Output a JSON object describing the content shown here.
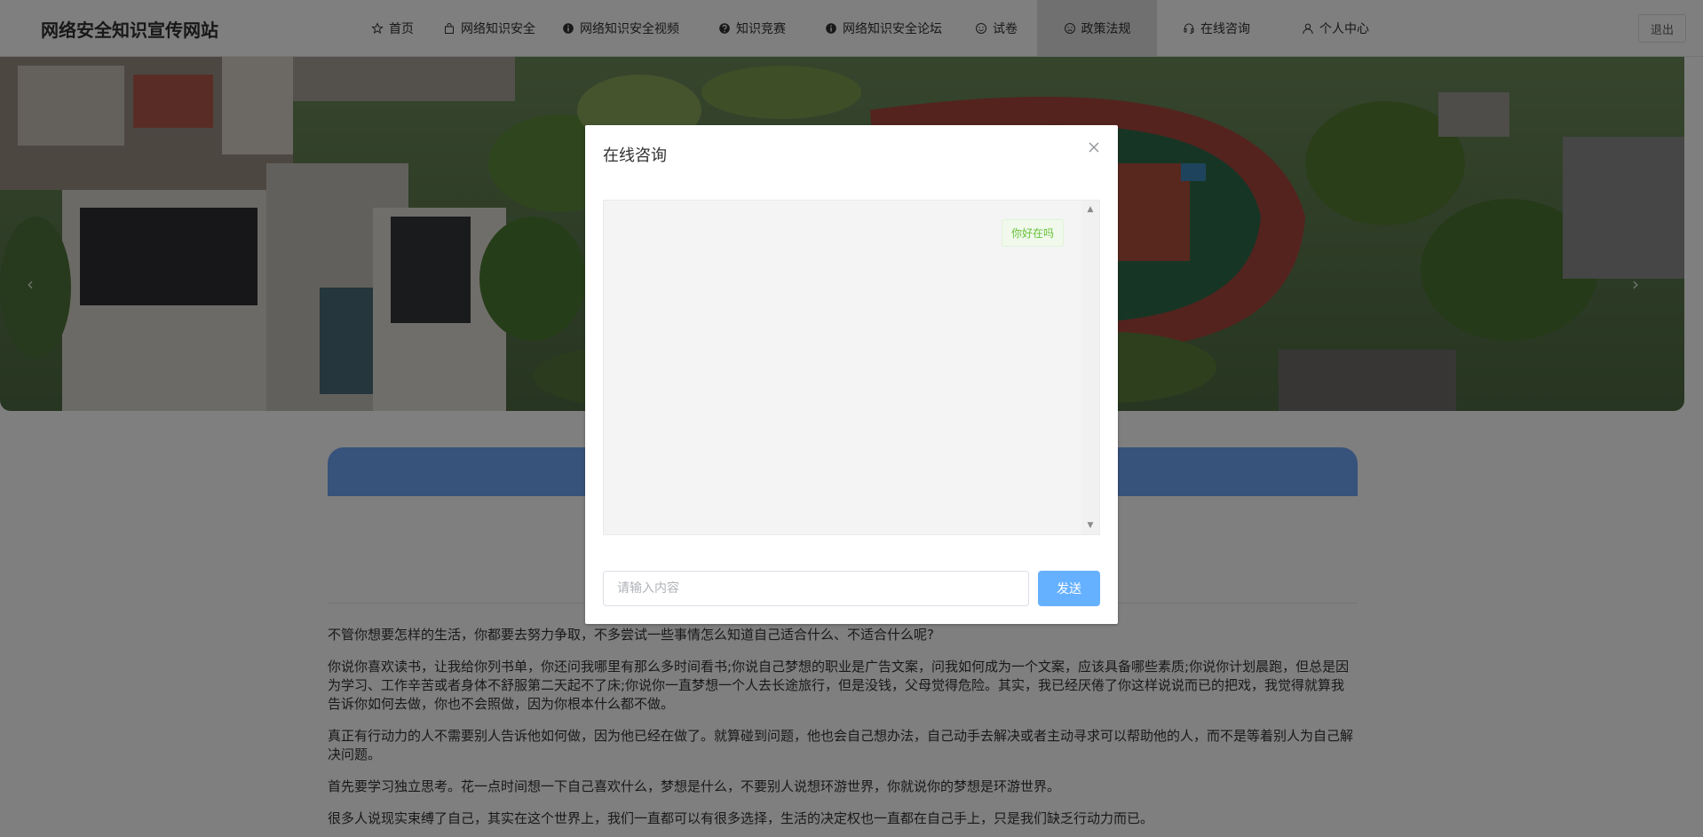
{
  "header": {
    "site_title": "网络安全知识宣传网站",
    "logout_label": "退出",
    "nav": [
      {
        "label": "首页",
        "icon": "star-icon",
        "active": false
      },
      {
        "label": "网络知识安全",
        "icon": "bag-icon",
        "active": false
      },
      {
        "label": "网络知识安全视频",
        "icon": "info-icon",
        "active": false
      },
      {
        "label": "知识竞赛",
        "icon": "question-icon",
        "active": false
      },
      {
        "label": "网络知识安全论坛",
        "icon": "info-icon",
        "active": false
      },
      {
        "label": "试卷",
        "icon": "smile-icon",
        "active": false
      },
      {
        "label": "政策法规",
        "icon": "sad-icon",
        "active": true
      },
      {
        "label": "在线咨询",
        "icon": "headset-icon",
        "active": false
      },
      {
        "label": "个人中心",
        "icon": "user-icon",
        "active": false
      }
    ]
  },
  "banner": {
    "prev_arrow": "‹",
    "next_arrow": "›"
  },
  "article": {
    "title": "",
    "paragraphs": [
      "不管你想要怎样的生活，你都要去努力争取，不多尝试一些事情怎么知道自己适合什么、不适合什么呢?",
      "你说你喜欢读书，让我给你列书单，你还问我哪里有那么多时间看书;你说自己梦想的职业是广告文案，问我如何成为一个文案，应该具备哪些素质;你说你计划晨跑，但总是因为学习、工作辛苦或者身体不舒服第二天起不了床;你说你一直梦想一个人去长途旅行，但是没钱，父母觉得危险。其实，我已经厌倦了你这样说说而已的把戏，我觉得就算我告诉你如何去做，你也不会照做，因为你根本什么都不做。",
      "真正有行动力的人不需要别人告诉他如何做，因为他已经在做了。就算碰到问题，他也会自己想办法，自己动手去解决或者主动寻求可以帮助他的人，而不是等着别人为自己解决问题。",
      "首先要学习独立思考。花一点时间想一下自己喜欢什么，梦想是什么，不要别人说想环游世界，你就说你的梦想是环游世界。",
      "很多人说现实束缚了自己，其实在这个世界上，我们一直都可以有很多选择，生活的决定权也一直都在自己手上，只是我们缺乏行动力而已。"
    ]
  },
  "dialog": {
    "title": "在线咨询",
    "messages": [
      {
        "text": "你好在吗",
        "side": "right"
      }
    ],
    "scroll_up": "▲",
    "scroll_down": "▼",
    "input_placeholder": "请输入内容",
    "input_value": "",
    "send_label": "发送"
  },
  "colors": {
    "accent": "#66b1ff",
    "title_bar": "#6fa6f6",
    "message_text": "#67c23a",
    "nav_active_bg": "#e0e0e0"
  }
}
